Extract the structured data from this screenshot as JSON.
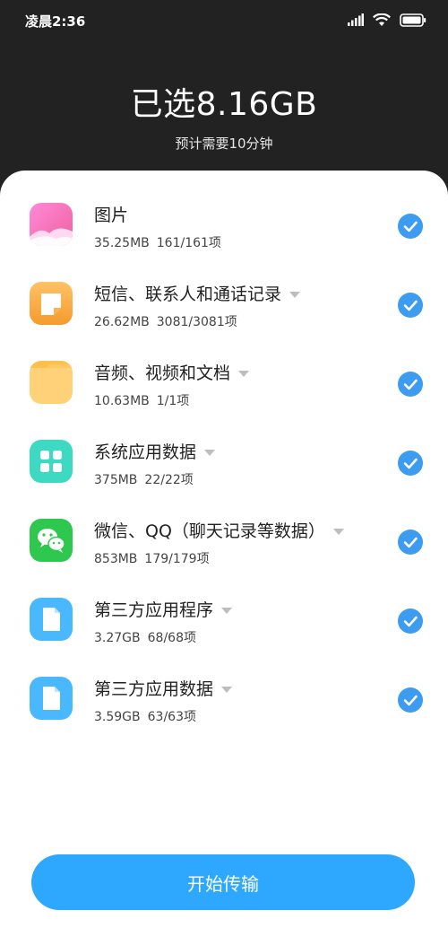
{
  "status_bar": {
    "time": "凌晨2:36",
    "icons": [
      "signal-icon",
      "wifi-icon",
      "battery-icon"
    ]
  },
  "header": {
    "title": "已选8.16GB",
    "subtitle": "预计需要10分钟"
  },
  "items": [
    {
      "title": "图片",
      "size": "35.25MB",
      "count": "161/161项",
      "icon": "photos-icon",
      "has_dropdown": false,
      "checked": true
    },
    {
      "title": "短信、联系人和通话记录",
      "size": "26.62MB",
      "count": "3081/3081项",
      "icon": "messages-icon",
      "has_dropdown": true,
      "checked": true
    },
    {
      "title": "音频、视频和文档",
      "size": "10.63MB",
      "count": "1/1项",
      "icon": "folder-icon",
      "has_dropdown": true,
      "checked": true
    },
    {
      "title": "系统应用数据",
      "size": "375MB",
      "count": "22/22项",
      "icon": "apps-grid-icon",
      "has_dropdown": true,
      "checked": true
    },
    {
      "title": "微信、QQ（聊天记录等数据）",
      "size": "853MB",
      "count": "179/179项",
      "icon": "wechat-icon",
      "has_dropdown": true,
      "checked": true
    },
    {
      "title": "第三方应用程序",
      "size": "3.27GB",
      "count": "68/68项",
      "icon": "document-icon",
      "has_dropdown": true,
      "checked": true
    },
    {
      "title": "第三方应用数据",
      "size": "3.59GB",
      "count": "63/63项",
      "icon": "document-icon",
      "has_dropdown": true,
      "checked": true
    }
  ],
  "footer": {
    "start_label": "开始传输"
  },
  "colors": {
    "header_bg": "#222222",
    "accent": "#2ea7ff",
    "check": "#3d9bf0"
  }
}
